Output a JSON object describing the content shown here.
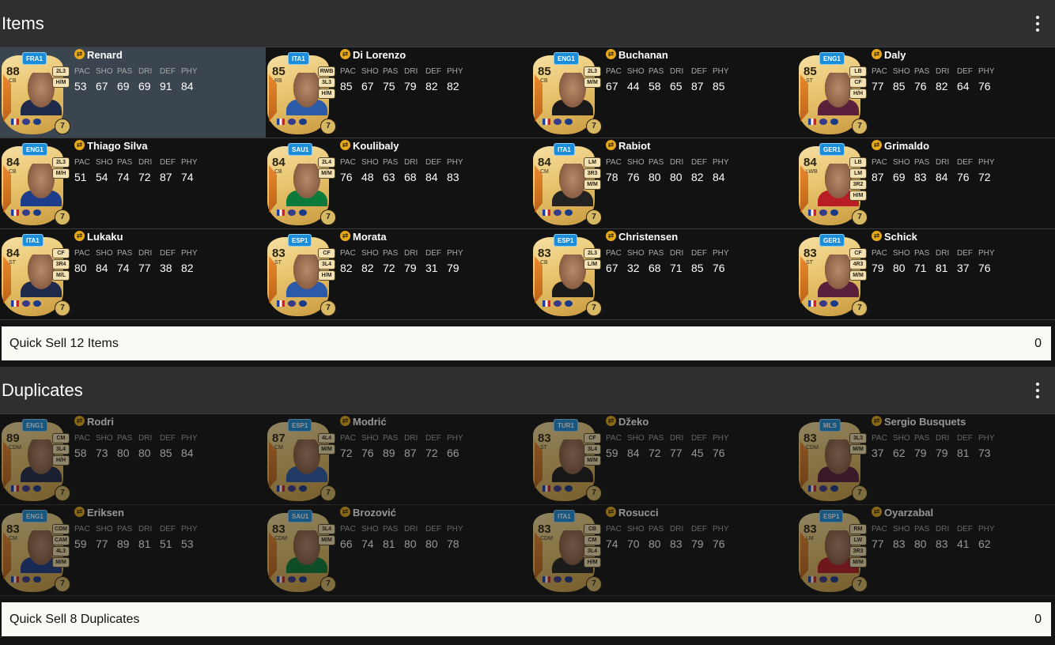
{
  "items_section": {
    "title": "Items",
    "quick_sell_label": "Quick Sell 12 Items",
    "quick_sell_value": "0",
    "cards": [
      {
        "name": "Renard",
        "rating": "88",
        "position": "CB",
        "league": "FRA1",
        "playstyles": [
          "2L3",
          "H/M"
        ],
        "stats": [
          "53",
          "67",
          "69",
          "69",
          "91",
          "84"
        ],
        "chem": "7",
        "selected": true
      },
      {
        "name": "Di Lorenzo",
        "rating": "85",
        "position": "RB",
        "league": "ITA1",
        "playstyles": [
          "RWB",
          "3L3",
          "H/M"
        ],
        "stats": [
          "85",
          "67",
          "75",
          "79",
          "82",
          "82"
        ],
        "chem": "7"
      },
      {
        "name": "Buchanan",
        "rating": "85",
        "position": "CB",
        "league": "ENG1",
        "playstyles": [
          "2L3",
          "M/M"
        ],
        "stats": [
          "67",
          "44",
          "58",
          "65",
          "87",
          "85"
        ],
        "chem": "7"
      },
      {
        "name": "Daly",
        "rating": "85",
        "position": "ST",
        "league": "ENG1",
        "playstyles": [
          "LB",
          "CF",
          "H/H"
        ],
        "stats": [
          "77",
          "85",
          "76",
          "82",
          "64",
          "76"
        ],
        "chem": "7"
      },
      {
        "name": "Thiago Silva",
        "rating": "84",
        "position": "CB",
        "league": "ENG1",
        "playstyles": [
          "2L3",
          "M/H"
        ],
        "stats": [
          "51",
          "54",
          "74",
          "72",
          "87",
          "74"
        ],
        "chem": "7"
      },
      {
        "name": "Koulibaly",
        "rating": "84",
        "position": "CB",
        "league": "SAU1",
        "playstyles": [
          "2L4",
          "M/M"
        ],
        "stats": [
          "76",
          "48",
          "63",
          "68",
          "84",
          "83"
        ],
        "chem": "7"
      },
      {
        "name": "Rabiot",
        "rating": "84",
        "position": "CM",
        "league": "ITA1",
        "playstyles": [
          "LM",
          "3R3",
          "M/M"
        ],
        "stats": [
          "78",
          "76",
          "80",
          "80",
          "82",
          "84"
        ],
        "chem": "7"
      },
      {
        "name": "Grimaldo",
        "rating": "84",
        "position": "LWB",
        "league": "GER1",
        "playstyles": [
          "LB",
          "LM",
          "3R2",
          "H/M"
        ],
        "stats": [
          "87",
          "69",
          "83",
          "84",
          "76",
          "72"
        ],
        "chem": "7"
      },
      {
        "name": "Lukaku",
        "rating": "84",
        "position": "ST",
        "league": "ITA1",
        "playstyles": [
          "CF",
          "3R4",
          "M/L"
        ],
        "stats": [
          "80",
          "84",
          "74",
          "77",
          "38",
          "82"
        ],
        "chem": "7"
      },
      {
        "name": "Morata",
        "rating": "83",
        "position": "ST",
        "league": "ESP1",
        "playstyles": [
          "CF",
          "3L4",
          "H/M"
        ],
        "stats": [
          "82",
          "82",
          "72",
          "79",
          "31",
          "79"
        ],
        "chem": "7"
      },
      {
        "name": "Christensen",
        "rating": "83",
        "position": "CB",
        "league": "ESP1",
        "playstyles": [
          "2L3",
          "L/M"
        ],
        "stats": [
          "67",
          "32",
          "68",
          "71",
          "85",
          "76"
        ],
        "chem": "7"
      },
      {
        "name": "Schick",
        "rating": "83",
        "position": "ST",
        "league": "GER1",
        "playstyles": [
          "CF",
          "4R3",
          "M/M"
        ],
        "stats": [
          "79",
          "80",
          "71",
          "81",
          "37",
          "76"
        ],
        "chem": "7"
      }
    ]
  },
  "duplicates_section": {
    "title": "Duplicates",
    "quick_sell_label": "Quick Sell 8 Duplicates",
    "quick_sell_value": "0",
    "cards": [
      {
        "name": "Rodri",
        "rating": "89",
        "position": "CDM",
        "league": "ENG1",
        "playstyles": [
          "CM",
          "3L4",
          "H/H"
        ],
        "stats": [
          "58",
          "73",
          "80",
          "80",
          "85",
          "84"
        ],
        "chem": "7"
      },
      {
        "name": "Modrić",
        "rating": "87",
        "position": "CM",
        "league": "ESP1",
        "playstyles": [
          "4L4",
          "M/M"
        ],
        "stats": [
          "72",
          "76",
          "89",
          "87",
          "72",
          "66"
        ],
        "chem": "7"
      },
      {
        "name": "Džeko",
        "rating": "83",
        "position": "ST",
        "league": "TUR1",
        "playstyles": [
          "CF",
          "3L4",
          "M/M"
        ],
        "stats": [
          "59",
          "84",
          "72",
          "77",
          "45",
          "76"
        ],
        "chem": "7"
      },
      {
        "name": "Sergio Busquets",
        "rating": "83",
        "position": "CDM",
        "league": "MLS",
        "playstyles": [
          "3L3",
          "M/M"
        ],
        "stats": [
          "37",
          "62",
          "79",
          "79",
          "81",
          "73"
        ],
        "chem": "7"
      },
      {
        "name": "Eriksen",
        "rating": "83",
        "position": "CM",
        "league": "ENG1",
        "playstyles": [
          "CDM",
          "CAM",
          "4L3",
          "M/M"
        ],
        "stats": [
          "59",
          "77",
          "89",
          "81",
          "51",
          "53"
        ],
        "chem": "7"
      },
      {
        "name": "Brozović",
        "rating": "83",
        "position": "CDM",
        "league": "SAU1",
        "playstyles": [
          "3L4",
          "M/M"
        ],
        "stats": [
          "66",
          "74",
          "81",
          "80",
          "80",
          "78"
        ],
        "chem": "7"
      },
      {
        "name": "Rosucci",
        "rating": "83",
        "position": "CDM",
        "league": "ITA1",
        "playstyles": [
          "CB",
          "CM",
          "3L4",
          "H/M"
        ],
        "stats": [
          "74",
          "70",
          "80",
          "83",
          "79",
          "76"
        ],
        "chem": "7"
      },
      {
        "name": "Oyarzabal",
        "rating": "83",
        "position": "LM",
        "league": "ESP1",
        "playstyles": [
          "RM",
          "LW",
          "3R3",
          "M/M"
        ],
        "stats": [
          "77",
          "83",
          "80",
          "83",
          "41",
          "62"
        ],
        "chem": "7"
      }
    ]
  },
  "stat_labels": [
    "PAC",
    "SHO",
    "PAS",
    "DRI",
    "DEF",
    "PHY"
  ],
  "icons": {
    "menu": "kebab-menu-icon",
    "evolution": "evolution-icon"
  },
  "colors": {
    "header_bg": "#2f2f2f",
    "page_bg": "#141414",
    "selected_tile": "#3a4550",
    "league_badge": "#1c8ed9",
    "evolution": "#e5a91b"
  }
}
